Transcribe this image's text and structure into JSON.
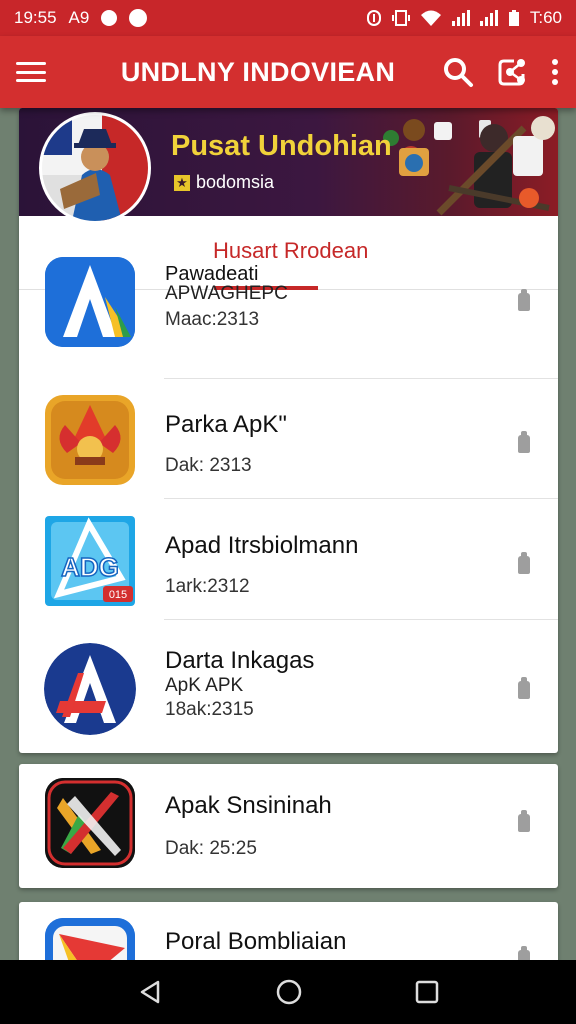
{
  "status_bar": {
    "time": "19:55",
    "left_text": "A9",
    "right_time": "T:60"
  },
  "app_bar": {
    "title": "UNDLNY INDOVIEAN",
    "icons": [
      "menu-icon",
      "search-icon",
      "share-icon",
      "more-vert-icon"
    ]
  },
  "header": {
    "title": "Pusat Undohian",
    "subtitle": "bodomsia"
  },
  "tab": {
    "label": "Husart Rrodean"
  },
  "apps": [
    {
      "name": "Pawadeati",
      "line2": "APWAGHEPC",
      "meta": "Maac:2313"
    },
    {
      "name": "Parka ApK\"",
      "line2": "",
      "meta": "Dak: 2313"
    },
    {
      "name": "Apad Itrsbiolmann",
      "line2": "",
      "meta": "1ark:2312"
    },
    {
      "name": "Darta Inkagas",
      "line2": "ApK APK",
      "meta": "18ak:2315"
    },
    {
      "name": "Apak Snsininah",
      "line2": "",
      "meta": "Dak: 25:25"
    },
    {
      "name": "Poral Bombliaian",
      "line2": "",
      "meta": ""
    }
  ],
  "icon_badge": "015",
  "colors": {
    "primary": "#d32f2f",
    "status_bar": "#c8262a",
    "accent_text": "#c62828",
    "banner_title": "#f1d23a",
    "background": "#6f8070"
  }
}
